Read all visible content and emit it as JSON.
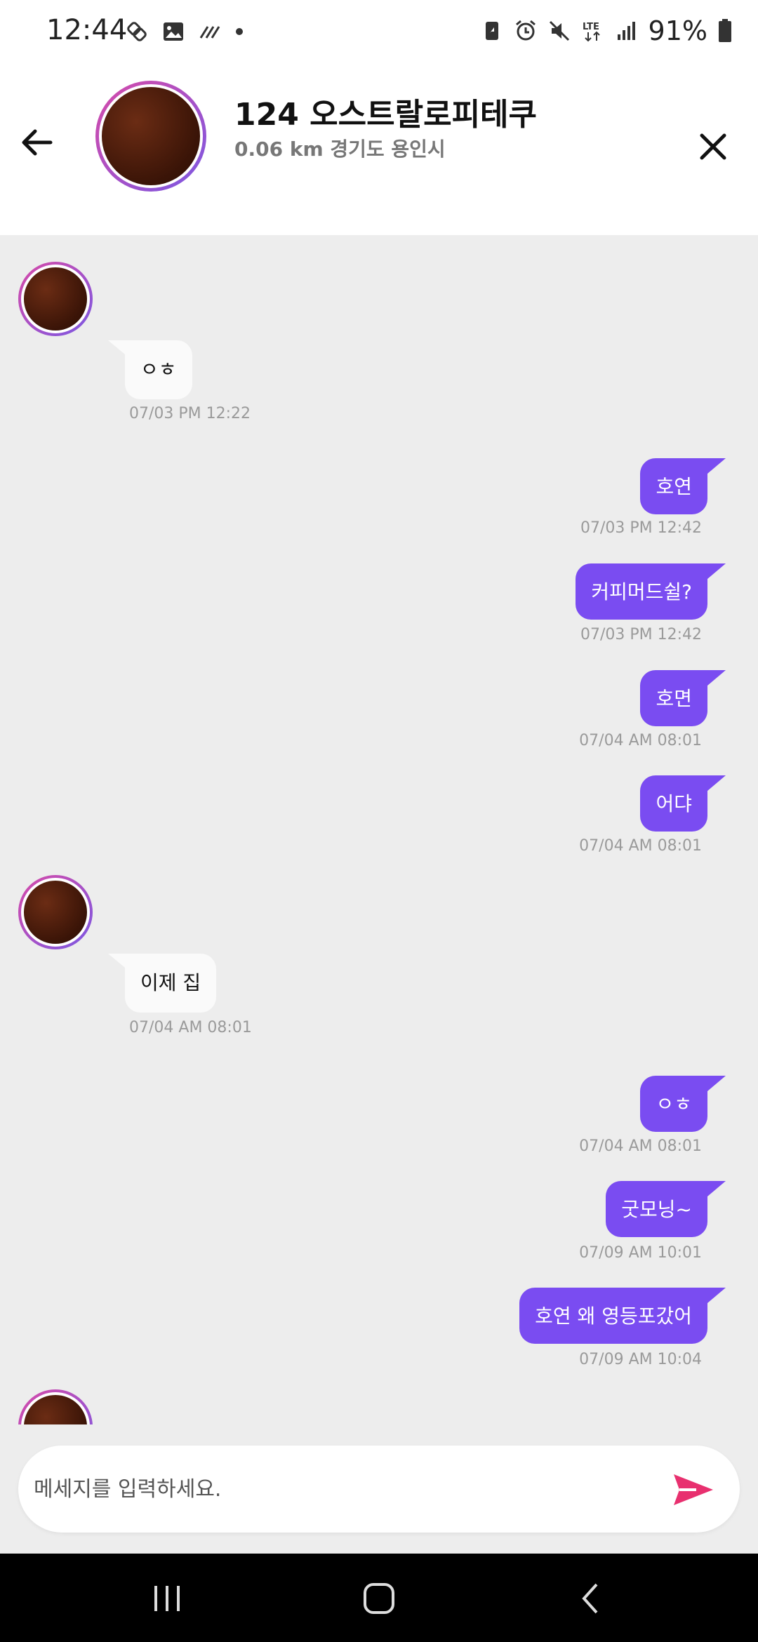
{
  "status": {
    "time": "12:44",
    "battery_text": "91%",
    "network": "LTE"
  },
  "header": {
    "title": "124 오스트랄로피테쿠",
    "subtitle": "0.06 km 경기도 용인시"
  },
  "messages": [
    {
      "dir": "in",
      "text": "ㅇㅎ",
      "time": "07/03 PM 12:22"
    },
    {
      "dir": "out",
      "text": "호연",
      "time": "07/03 PM 12:42"
    },
    {
      "dir": "out",
      "text": "커피머드쉴?",
      "time": "07/03 PM 12:42"
    },
    {
      "dir": "out",
      "text": "호면",
      "time": "07/04 AM 08:01"
    },
    {
      "dir": "out",
      "text": "어댜",
      "time": "07/04 AM 08:01"
    },
    {
      "dir": "in",
      "text": "이제 집",
      "time": "07/04 AM 08:01"
    },
    {
      "dir": "out",
      "text": "ㅇㅎ",
      "time": "07/04 AM 08:01"
    },
    {
      "dir": "out",
      "text": "굿모닝~",
      "time": "07/09 AM 10:01"
    },
    {
      "dir": "out",
      "text": "호연 왜 영등포갔어",
      "time": "07/09 AM 10:04"
    }
  ],
  "input": {
    "placeholder": "메세지를 입력하세요."
  },
  "colors": {
    "accent": "#7a4cf1",
    "send": "#e8306f",
    "avatar_ring_start": "#d74aa8",
    "avatar_ring_end": "#7b58e3"
  },
  "icons": {
    "back": "arrow-left-icon",
    "close": "close-icon",
    "send": "send-icon"
  }
}
